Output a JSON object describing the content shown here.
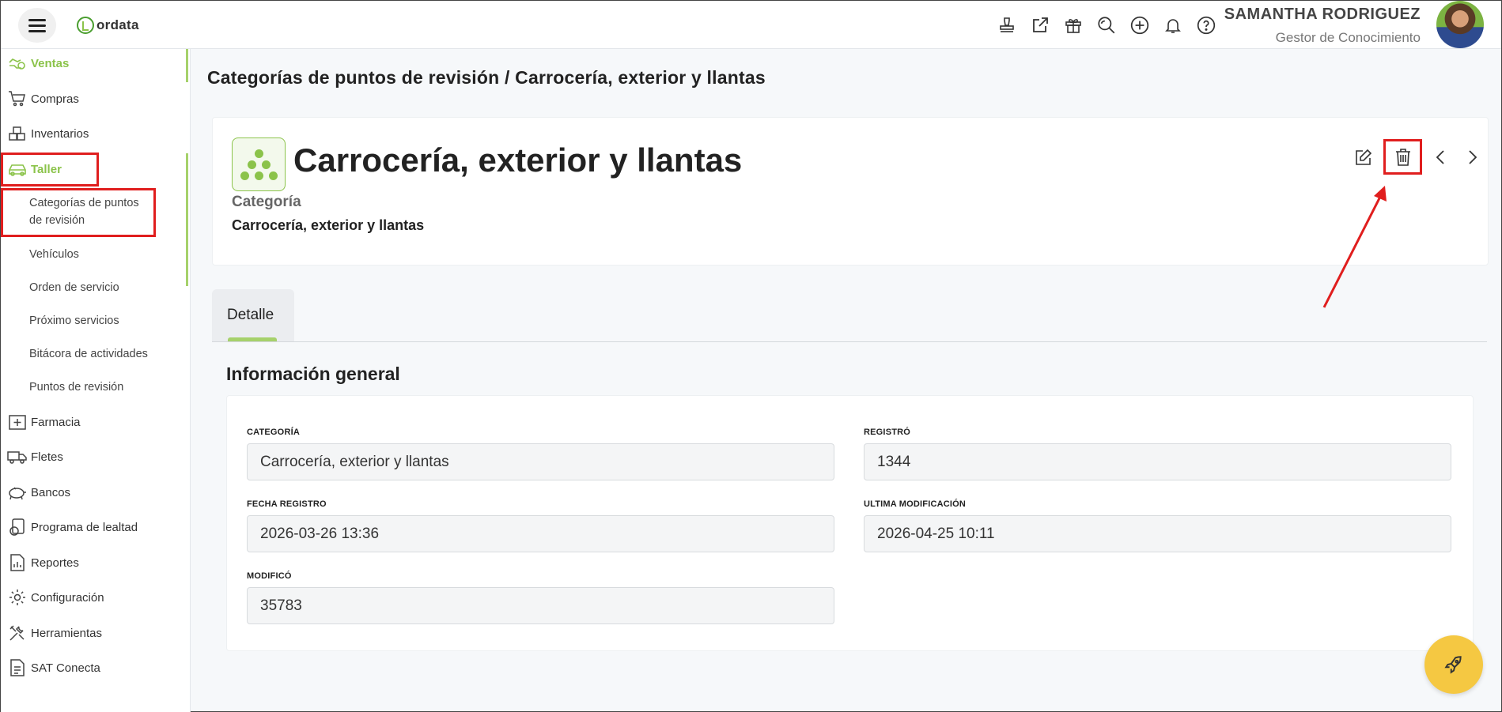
{
  "app": {
    "logo_text": "ordata"
  },
  "header": {
    "user_name": "SAMANTHA RODRIGUEZ",
    "user_role": "Gestor de Conocimiento",
    "icons": [
      "stamp-icon",
      "external-link-icon",
      "gift-icon",
      "search-zoom-icon",
      "plus-circle-icon",
      "bell-icon",
      "help-icon"
    ]
  },
  "sidebar": {
    "items": [
      {
        "label": "Ventas",
        "icon": "money-icon"
      },
      {
        "label": "Compras",
        "icon": "cart-icon"
      },
      {
        "label": "Inventarios",
        "icon": "boxes-icon"
      },
      {
        "label": "Taller",
        "icon": "car-icon"
      },
      {
        "label": "Farmacia",
        "icon": "pharmacy-icon"
      },
      {
        "label": "Fletes",
        "icon": "truck-icon"
      },
      {
        "label": "Bancos",
        "icon": "piggy-bank-icon"
      },
      {
        "label": "Programa de lealtad",
        "icon": "loyalty-icon"
      },
      {
        "label": "Reportes",
        "icon": "report-icon"
      },
      {
        "label": "Configuración",
        "icon": "gear-icon"
      },
      {
        "label": "Herramientas",
        "icon": "tools-icon"
      },
      {
        "label": "SAT Conecta",
        "icon": "document-icon"
      }
    ],
    "taller_sub": {
      "cat_line1": "Categorías de puntos",
      "cat_line2": "de revisión",
      "vehiculos": "Vehículos",
      "orden": "Orden de servicio",
      "proximo": "Próximo servicios",
      "bitacora": "Bitácora de actividades",
      "puntos": "Puntos de revisión"
    }
  },
  "breadcrumb": {
    "parent": "Categorías de puntos de revisión",
    "separator": "/",
    "current": "Carrocería, exterior y llantas"
  },
  "record": {
    "title": "Carrocería, exterior y llantas",
    "label": "Categoría",
    "value": "Carrocería, exterior y llantas"
  },
  "tabs": [
    {
      "label": "Detalle"
    }
  ],
  "section": {
    "title": "Información general",
    "fields": {
      "categoria_label": "CATEGORÍA",
      "categoria_value": "Carrocería, exterior y llantas",
      "registro_label": "REGISTRÓ",
      "registro_value": "1344",
      "fecha_label": "FECHA REGISTRO",
      "fecha_value": "2026-03-26 13:36",
      "ultima_label": "ULTIMA MODIFICACIÓN",
      "ultima_value": "2026-04-25 10:11",
      "modifico_label": "MODIFICÓ",
      "modifico_value": "35783"
    }
  },
  "colors": {
    "accent": "#8bc34a",
    "highlight": "#e01e1e",
    "fab": "#f5c842"
  }
}
